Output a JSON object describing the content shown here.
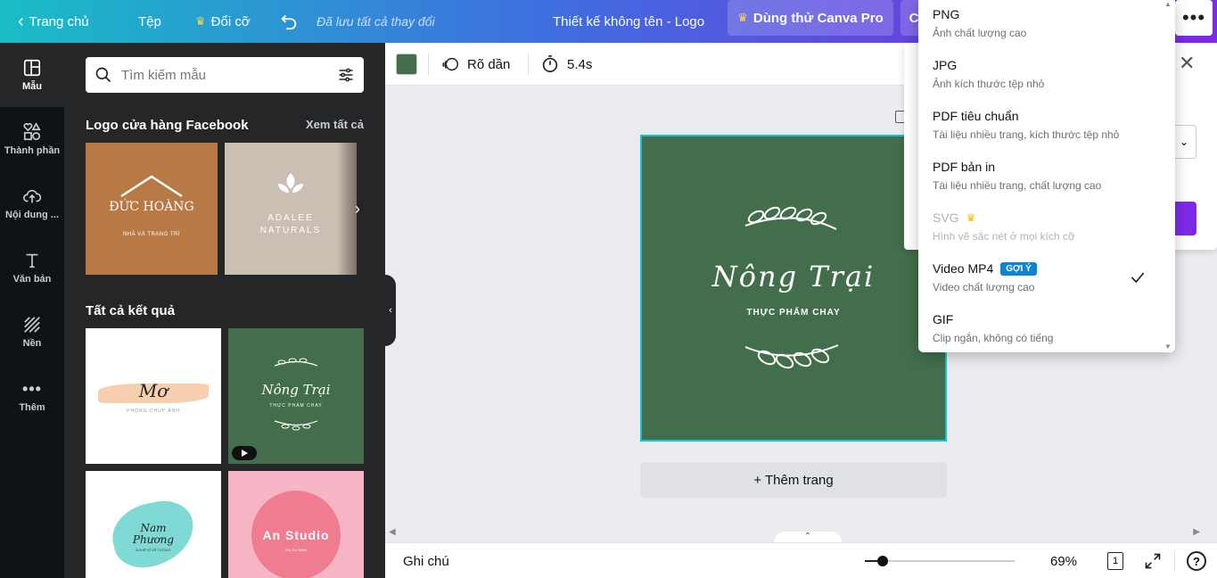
{
  "topbar": {
    "home_label": "Trang chủ",
    "file_label": "Tệp",
    "resize_label": "Đổi cỡ",
    "saved_status": "Đã lưu tất cả thay đổi",
    "design_title": "Thiết kế không tên - Logo",
    "pro_label": "Dùng thử Canva Pro",
    "share_partial": "C"
  },
  "rail": [
    {
      "label": "Mẫu",
      "icon": "template-icon"
    },
    {
      "label": "Thành phần",
      "icon": "elements-icon"
    },
    {
      "label": "Nội dung ...",
      "icon": "upload-icon"
    },
    {
      "label": "Văn bản",
      "icon": "text-icon"
    },
    {
      "label": "Nền",
      "icon": "background-icon"
    },
    {
      "label": "Thêm",
      "icon": "more-icon"
    }
  ],
  "panel": {
    "search_placeholder": "Tìm kiếm mẫu",
    "section1_title": "Logo cửa hàng Facebook",
    "see_all": "Xem tất cả",
    "section2_title": "Tất cả kết quả",
    "featured": [
      {
        "title": "ĐỨC HOÀNG",
        "subtitle": "NHÀ VÀ TRANG TRÍ",
        "bg": "#b87a45"
      },
      {
        "title": "ADALEE NATURALS",
        "bg": "#c9bcb0"
      }
    ],
    "results": [
      {
        "title": "Mơ",
        "subtitle": "PHÒNG CHỤP ẢNH",
        "bg": "#ffffff"
      },
      {
        "title": "Nông Trại",
        "subtitle": "THỰC PHẨM CHAY",
        "bg": "#426e4b"
      },
      {
        "title": "Nam Phương",
        "subtitle": "NGHỆ SĨ VẼ TƯỜNG",
        "bg": "#ffffff"
      },
      {
        "title": "An Studio",
        "subtitle": "GIA DU SINH",
        "bg": "#f7b6c6"
      }
    ]
  },
  "toolbar": {
    "color": "#426e4b",
    "fade_label": "Rõ dần",
    "duration": "5.4s"
  },
  "design": {
    "title": "Nông Trại",
    "subtitle": "THỰC PHẨM CHAY",
    "bg": "#426e4b"
  },
  "add_page": "+ Thêm trang",
  "bottom": {
    "notes": "Ghi chú",
    "zoom": "69%",
    "page_number": "1",
    "zoom_level": 0.69
  },
  "download_formats": [
    {
      "name": "PNG",
      "desc": "Ảnh chất lượng cao",
      "disabled": false
    },
    {
      "name": "JPG",
      "desc": "Ảnh kích thước tệp nhỏ",
      "disabled": false
    },
    {
      "name": "PDF tiêu chuẩn",
      "desc": "Tài liệu nhiều trang, kích thước tệp nhỏ",
      "disabled": false
    },
    {
      "name": "PDF bản in",
      "desc": "Tài liệu nhiều trang, chất lượng cao",
      "disabled": false
    },
    {
      "name": "SVG",
      "desc": "Hình vẽ sắc nét ở mọi kích cỡ",
      "disabled": true,
      "pro": true
    },
    {
      "name": "Video MP4",
      "desc": "Video chất lượng cao",
      "badge": "GỢI Ý",
      "selected": true
    },
    {
      "name": "GIF",
      "desc": "Clip ngắn, không có tiếng",
      "disabled": false
    }
  ]
}
